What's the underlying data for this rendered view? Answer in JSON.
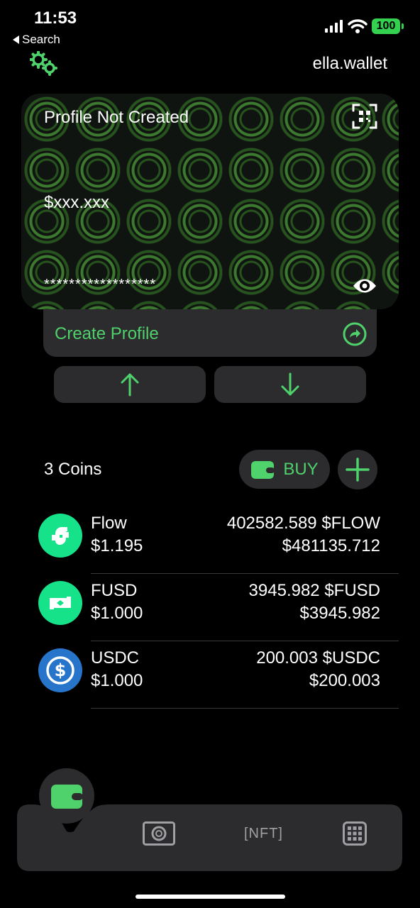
{
  "status_bar": {
    "time": "11:53",
    "back_label": "Search",
    "battery": "100"
  },
  "header": {
    "wallet_name": "ella.wallet"
  },
  "card": {
    "title": "Profile Not Created",
    "balance": "$xxx.xxx",
    "masked_address": "******************"
  },
  "create_profile": {
    "label": "Create Profile"
  },
  "coins": {
    "count_label": "3 Coins",
    "buy_label": "BUY",
    "items": [
      {
        "name": "Flow",
        "price": "$1.195",
        "amount": "402582.589 $FLOW",
        "value": "$481135.712"
      },
      {
        "name": "FUSD",
        "price": "$1.000",
        "amount": "3945.982 $FUSD",
        "value": "$3945.982"
      },
      {
        "name": "USDC",
        "price": "$1.000",
        "amount": "200.003 $USDC",
        "value": "$200.003"
      }
    ]
  },
  "tabbar": {
    "nft_label": "[NFT]"
  },
  "colors": {
    "accent": "#4fd16b",
    "surface": "#2c2c2e",
    "flow": "#16e28a",
    "usdc": "#2775ca"
  }
}
